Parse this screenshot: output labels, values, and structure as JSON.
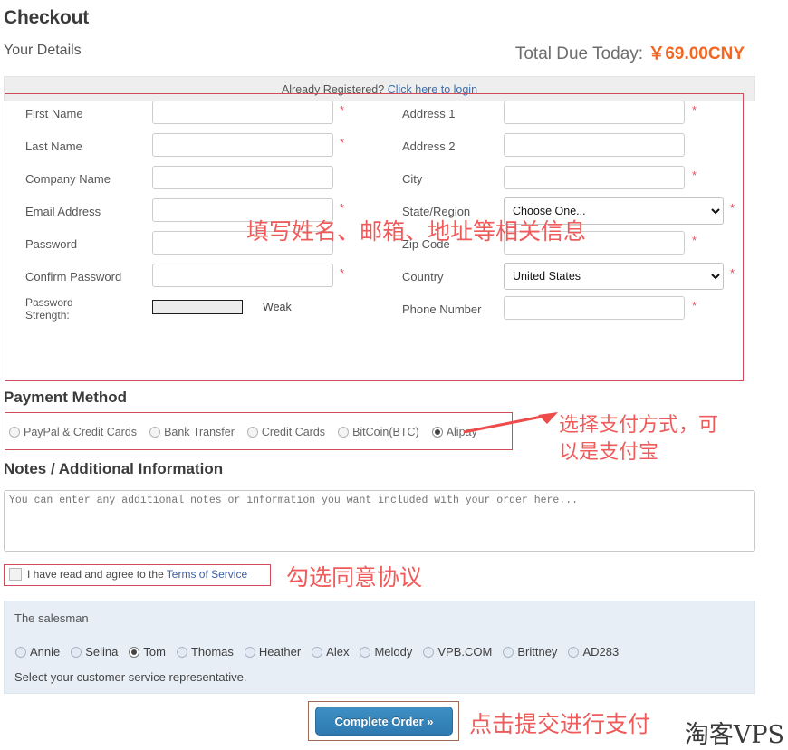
{
  "header": {
    "title": "Checkout",
    "subtitle": "Your Details",
    "total_label": "Total Due Today:",
    "total_amount": "￥69.00CNY",
    "total_accent_color": "#f26722"
  },
  "login_bar": {
    "text": "Already Registered?",
    "link": "Click here to login"
  },
  "details_form": {
    "left_fields": [
      {
        "label": "First Name",
        "value": "",
        "required": true,
        "type": "text"
      },
      {
        "label": "Last Name",
        "value": "",
        "required": true,
        "type": "text"
      },
      {
        "label": "Company Name",
        "value": "",
        "required": false,
        "type": "text"
      },
      {
        "label": "Email Address",
        "value": "",
        "required": true,
        "type": "text"
      },
      {
        "label": "Password",
        "value": "",
        "required": true,
        "type": "password"
      },
      {
        "label": "Confirm Password",
        "value": "",
        "required": true,
        "type": "password"
      }
    ],
    "password_strength": {
      "label_line1": "Password",
      "label_line2": "Strength:",
      "value": "Weak",
      "percent": 0
    },
    "right_fields": [
      {
        "label": "Address 1",
        "value": "",
        "required": true,
        "type": "text"
      },
      {
        "label": "Address 2",
        "value": "",
        "required": false,
        "type": "text"
      },
      {
        "label": "City",
        "value": "",
        "required": true,
        "type": "text"
      },
      {
        "label": "State/Region",
        "value": "Choose One...",
        "required": true,
        "type": "select"
      },
      {
        "label": "Zip Code",
        "value": "",
        "required": true,
        "type": "text"
      },
      {
        "label": "Country",
        "value": "United States",
        "required": true,
        "type": "select"
      },
      {
        "label": "Phone Number",
        "value": "",
        "required": true,
        "type": "text"
      }
    ],
    "required_marker": "*"
  },
  "payment": {
    "title": "Payment Method",
    "options": [
      {
        "label": "PayPal & Credit Cards",
        "selected": false
      },
      {
        "label": "Bank Transfer",
        "selected": false
      },
      {
        "label": "Credit Cards",
        "selected": false
      },
      {
        "label": "BitCoin(BTC)",
        "selected": false
      },
      {
        "label": "Alipay",
        "selected": true
      }
    ]
  },
  "notes": {
    "title": "Notes / Additional Information",
    "value": "",
    "placeholder": "You can enter any additional notes or information you want included with your order here..."
  },
  "terms": {
    "text": "I have read and agree to the",
    "link": "Terms of Service",
    "checked": false
  },
  "salesman": {
    "title": "The salesman",
    "hint": "Select your customer service representative.",
    "options": [
      {
        "label": "Annie",
        "selected": false
      },
      {
        "label": "Selina",
        "selected": false
      },
      {
        "label": "Tom",
        "selected": true
      },
      {
        "label": "Thomas",
        "selected": false
      },
      {
        "label": "Heather",
        "selected": false
      },
      {
        "label": "Alex",
        "selected": false
      },
      {
        "label": "Melody",
        "selected": false
      },
      {
        "label": "VPB.COM",
        "selected": false
      },
      {
        "label": "Brittney",
        "selected": false
      },
      {
        "label": "AD283",
        "selected": false
      }
    ]
  },
  "submit": {
    "label": "Complete Order »"
  },
  "annotations": {
    "color": "#ef5b5b",
    "form": "填写姓名、邮箱、地址等相关信息",
    "payment_line1": "选择支付方式，可",
    "payment_line2": "以是支付宝",
    "terms": "勾选同意协议",
    "submit": "点击提交进行支付"
  },
  "watermark": "淘客VPS"
}
